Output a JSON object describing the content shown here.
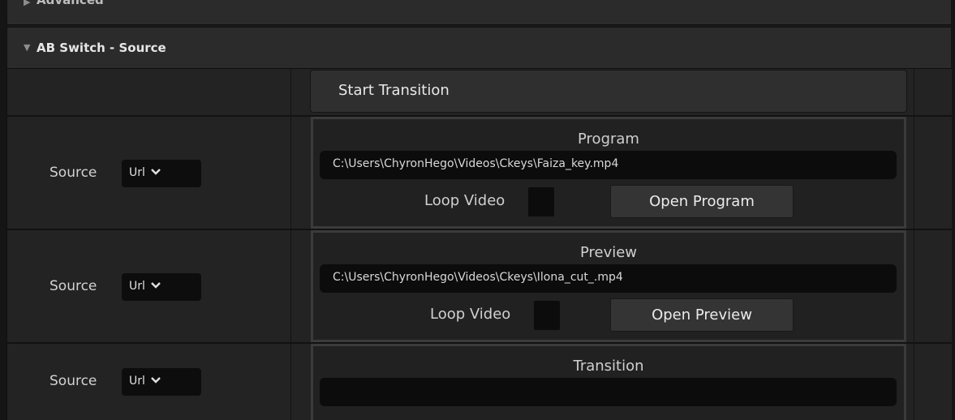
{
  "categories": {
    "advanced": {
      "title": "Advanced",
      "expanded": false
    },
    "ab_switch": {
      "title": "AB Switch - Source",
      "expanded": true
    }
  },
  "start_button": {
    "label": "Start Transition"
  },
  "program": {
    "source_label": "Source",
    "source_value": "Url",
    "header": "Program",
    "path": "C:\\Users\\ChyronHego\\Videos\\Ckeys\\Faiza_key.mp4",
    "loop_label": "Loop Video",
    "loop_checked": false,
    "open_label": "Open Program"
  },
  "preview": {
    "source_label": "Source",
    "source_value": "Url",
    "header": "Preview",
    "path": "C:\\Users\\ChyronHego\\Videos\\Ckeys\\Ilona_cut_.mp4",
    "loop_label": "Loop Video",
    "loop_checked": false,
    "open_label": "Open Preview"
  },
  "transition": {
    "source_label": "Source",
    "source_value": "Url",
    "header": "Transition",
    "path": ""
  },
  "icons": {
    "collapsed": "triangle-right-icon",
    "expanded": "triangle-down-icon",
    "dropdown": "chevron-down-icon"
  }
}
